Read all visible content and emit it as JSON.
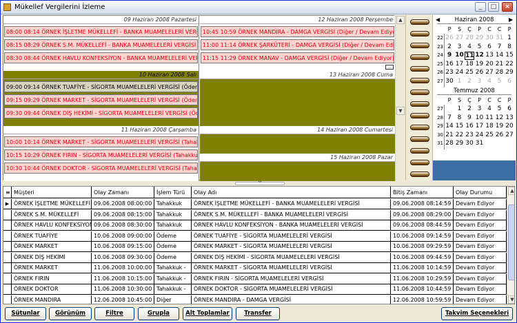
{
  "window": {
    "title": "Mükellef Vergilerini İzleme"
  },
  "schedule": {
    "days": [
      {
        "header": "09 Haziran 2008 Pazartesi",
        "olive": false,
        "appointments": [
          {
            "text": "08:00 08:14 ÖRNEK İŞLETME MÜKELLEFİ - BANKA MUAMELELERİ VERGİSİ",
            "style": "red"
          },
          {
            "text": "08:15 08:29 ÖRNEK S.M. MÜKELLEFİ - BANKA MUAMELELERİ VERGİSİ",
            "style": "red"
          },
          {
            "text": "08:30 08:44 ÖRNEK HAVLU KONFEKSİYON - BANKA MUAMELELERİ VERGİSİ",
            "style": "red"
          }
        ]
      },
      {
        "header": "12 Haziran 2008 Perşembe",
        "olive": false,
        "appointments": [
          {
            "text": "10:45 10:59 ÖRNEK MANDIRA - DAMGA VERGİSİ (Diğer / Devam Ediyor)",
            "style": "red"
          },
          {
            "text": "11:00 11:14 ÖRNEK ŞARKÜTERİ - DAMGA VERGİSİ (Diğer / Devam Ediyor)",
            "style": "red"
          },
          {
            "text": "11:15 11:29 ÖRNEK MANAV - DAMGA VERGİSİ (Diğer / Devam Ediyor)",
            "style": "red"
          }
        ]
      },
      {
        "header": "10 Haziran 2008 Salı",
        "olive": true,
        "appointments": [
          {
            "text": "09:00 09:14 ÖRNEK TUAFİYE - SİGORTA MUAMELELERİ VERGİSİ (Ödeme)",
            "style": "olv"
          },
          {
            "text": "09:15 09:29 ÖRNEK MARKET - SİGORTA MUAMELELERİ VERGİSİ (Ödeme)",
            "style": "red"
          },
          {
            "text": "09:30 09:44 ÖRNEK DİŞ HEKİMİ - SİGORTA MUAMELELERİ VERGİSİ (Ödeme)",
            "style": "red"
          }
        ]
      },
      {
        "header": "13 Haziran 2008 Cuma",
        "olive": false,
        "appointments": []
      },
      {
        "header": "11 Haziran 2008 Çarşamba",
        "olive": false,
        "appointments": [
          {
            "text": "10:00 10:14 ÖRNEK MARKET - SİGORTA MUAMELELERİ VERGİSİ (Tahakkuk)",
            "style": "red"
          },
          {
            "text": "10:15 10:29 ÖRNEK FIRIN - SİGORTA MUAMELELERİ VERGİSİ (Tahakkuk)",
            "style": "red"
          },
          {
            "text": "10:30 10:44 ÖRNEK DOKTOR - SİGORTA MUAMELELERİ VERGİSİ (Tahakkuk)",
            "style": "red"
          }
        ]
      },
      {
        "header": "14 Haziran 2008 Cumartesi",
        "olive": false,
        "appointments": []
      },
      {
        "header": "15 Haziran 2008 Pazar",
        "olive": false,
        "appointments": []
      }
    ]
  },
  "calendar": {
    "months": [
      {
        "title": "Haziran 2008",
        "dow": [
          "P",
          "S",
          "Ç",
          "P",
          "C",
          "C",
          "P"
        ],
        "weeks": [
          {
            "num": "22",
            "days": [
              {
                "d": "26",
                "c": "gray"
              },
              {
                "d": "27",
                "c": "gray"
              },
              {
                "d": "28",
                "c": "gray"
              },
              {
                "d": "29",
                "c": "gray"
              },
              {
                "d": "30",
                "c": "gray"
              },
              {
                "d": "31",
                "c": "gray"
              },
              {
                "d": "1",
                "c": ""
              }
            ]
          },
          {
            "num": "23",
            "days": [
              {
                "d": "2",
                "c": ""
              },
              {
                "d": "3",
                "c": ""
              },
              {
                "d": "4",
                "c": ""
              },
              {
                "d": "5",
                "c": ""
              },
              {
                "d": "6",
                "c": ""
              },
              {
                "d": "7",
                "c": ""
              },
              {
                "d": "8",
                "c": ""
              }
            ]
          },
          {
            "num": "24",
            "days": [
              {
                "d": "9",
                "c": "bold"
              },
              {
                "d": "10",
                "c": "bold"
              },
              {
                "d": "11",
                "c": "bold today"
              },
              {
                "d": "12",
                "c": "bold"
              },
              {
                "d": "13",
                "c": ""
              },
              {
                "d": "14",
                "c": ""
              },
              {
                "d": "15",
                "c": ""
              }
            ]
          },
          {
            "num": "25",
            "days": [
              {
                "d": "16",
                "c": ""
              },
              {
                "d": "17",
                "c": ""
              },
              {
                "d": "18",
                "c": ""
              },
              {
                "d": "19",
                "c": ""
              },
              {
                "d": "20",
                "c": ""
              },
              {
                "d": "21",
                "c": ""
              },
              {
                "d": "22",
                "c": ""
              }
            ]
          },
          {
            "num": "26",
            "days": [
              {
                "d": "23",
                "c": ""
              },
              {
                "d": "24",
                "c": ""
              },
              {
                "d": "25",
                "c": ""
              },
              {
                "d": "26",
                "c": ""
              },
              {
                "d": "27",
                "c": ""
              },
              {
                "d": "28",
                "c": ""
              },
              {
                "d": "29",
                "c": ""
              }
            ]
          },
          {
            "num": "27",
            "days": [
              {
                "d": "30",
                "c": ""
              },
              {
                "d": "1",
                "c": "gray"
              },
              {
                "d": "2",
                "c": "gray"
              },
              {
                "d": "3",
                "c": "gray"
              },
              {
                "d": "4",
                "c": "gray"
              },
              {
                "d": "5",
                "c": "gray"
              },
              {
                "d": "6",
                "c": "gray"
              }
            ]
          }
        ]
      },
      {
        "title": "Temmuz 2008",
        "dow": [
          "P",
          "S",
          "Ç",
          "P",
          "C",
          "C",
          "P"
        ],
        "weeks": [
          {
            "num": "27",
            "days": [
              {
                "d": "",
                "c": ""
              },
              {
                "d": "1",
                "c": ""
              },
              {
                "d": "2",
                "c": ""
              },
              {
                "d": "3",
                "c": ""
              },
              {
                "d": "4",
                "c": ""
              },
              {
                "d": "5",
                "c": ""
              },
              {
                "d": "6",
                "c": ""
              }
            ]
          },
          {
            "num": "28",
            "days": [
              {
                "d": "7",
                "c": ""
              },
              {
                "d": "8",
                "c": ""
              },
              {
                "d": "9",
                "c": ""
              },
              {
                "d": "10",
                "c": ""
              },
              {
                "d": "11",
                "c": ""
              },
              {
                "d": "12",
                "c": ""
              },
              {
                "d": "13",
                "c": ""
              }
            ]
          },
          {
            "num": "29",
            "days": [
              {
                "d": "14",
                "c": ""
              },
              {
                "d": "15",
                "c": ""
              },
              {
                "d": "16",
                "c": ""
              },
              {
                "d": "17",
                "c": ""
              },
              {
                "d": "18",
                "c": ""
              },
              {
                "d": "19",
                "c": ""
              },
              {
                "d": "20",
                "c": ""
              }
            ]
          },
          {
            "num": "30",
            "days": [
              {
                "d": "21",
                "c": ""
              },
              {
                "d": "22",
                "c": ""
              },
              {
                "d": "23",
                "c": ""
              },
              {
                "d": "24",
                "c": ""
              },
              {
                "d": "25",
                "c": ""
              },
              {
                "d": "26",
                "c": ""
              },
              {
                "d": "27",
                "c": ""
              }
            ]
          },
          {
            "num": "31",
            "days": [
              {
                "d": "28",
                "c": ""
              },
              {
                "d": "29",
                "c": ""
              },
              {
                "d": "30",
                "c": ""
              },
              {
                "d": "31",
                "c": ""
              },
              {
                "d": "",
                "c": ""
              },
              {
                "d": "",
                "c": ""
              },
              {
                "d": "",
                "c": ""
              }
            ]
          }
        ]
      }
    ]
  },
  "grid": {
    "columns": [
      "Müşteri",
      "Olay Zamanı",
      "İşlem Türü",
      "Olay Adı",
      "Bitiş Zamanı",
      "Olay Durumu"
    ],
    "rows": [
      [
        "ÖRNEK İŞLETME MÜKELLEFİ",
        "09.06.2008 08:00:00",
        "Tahakkuk",
        "ÖRNEK İŞLETME MÜKELLEFİ - BANKA MUAMELELERİ VERGİSİ",
        "09.06.2008 08:14:59",
        "Devam Ediyor"
      ],
      [
        "ÖRNEK S.M. MÜKELLEFİ",
        "09.06.2008 08:15:00",
        "Tahakkuk",
        "ÖRNEK S.M. MÜKELLEFİ - BANKA MUAMELELERİ VERGİSİ",
        "09.06.2008 08:29:00",
        "Devam Ediyor"
      ],
      [
        "ÖRNEK HAVLU KONFEKSİYON",
        "09.06.2008 08:30:00",
        "Tahakkuk",
        "ÖRNEK HAVLU KONFEKSİYON - BANKA MUAMELELERİ VERGİSİ",
        "09.06.2008 08:44:59",
        "Devam Ediyor"
      ],
      [
        "ÖRNEK TUAFİYE",
        "10.06.2008 09:00:00",
        "Ödeme",
        "ÖRNEK TUAFİYE - SİGORTA MUAMELELERİ VERGİSİ",
        "10.06.2008 09:14:59",
        "Devam Ediyor"
      ],
      [
        "ÖRNEK MARKET",
        "10.06.2008 09:15:00",
        "Ödeme",
        "ÖRNEK MARKET - SİGORTA MUAMELELERİ VERGİSİ",
        "10.06.2008 09:29:59",
        "Devam Ediyor"
      ],
      [
        "ÖRNEK DİŞ HEKİMİ",
        "10.06.2008 09:30:00",
        "Ödeme",
        "ÖRNEK DİŞ HEKİMİ - SİGORTA MUAMELELERİ VERGİSİ",
        "10.06.2008 09:44:59",
        "Devam Ediyor"
      ],
      [
        "ÖRNEK MARKET",
        "11.06.2008 10:00:00",
        "Tahakkuk - ",
        "ÖRNEK MARKET - SİGORTA MUAMELELERİ VERGİSİ",
        "11.06.2008 10:14:59",
        "Devam Ediyor"
      ],
      [
        "ÖRNEK FIRIN",
        "11.06.2008 10:15:00",
        "Tahakkuk - ",
        "ÖRNEK FIRIN - SİGORTA MUAMELELERİ VERGİSİ",
        "11.06.2008 10:29:59",
        "Devam Ediyor"
      ],
      [
        "ÖRNEK DOKTOR",
        "11.06.2008 10:30:00",
        "Tahakkuk - ",
        "ÖRNEK DOKTOR - SİGORTA MUAMELELERİ VERGİSİ",
        "11.06.2008 10:44:59",
        "Devam Ediyor"
      ],
      [
        "ÖRNEK MANDIRA",
        "12.06.2008 10:45:00",
        "Diğer",
        "ÖRNEK MANDIRA - DAMGA VERGİSİ",
        "12.06.2008 10:59:59",
        "Devam Ediyor"
      ],
      [
        "ÖRNEK ŞARKÜTERİ",
        "12.06.2008 11:00:00",
        "Diğer",
        "ÖRNEK ŞARKÜTERİ - DAMGA VERGİSİ",
        "12.06.2008 11:14:59",
        "Devam Ediyor"
      ]
    ]
  },
  "buttons": {
    "columns": "Sütunlar",
    "view": "Görünüm",
    "filter": "Filtre",
    "group": "Grupla",
    "subtotals": "Alt Toplamlar",
    "transfer": "Transfer",
    "calendar_options": "Takvim Seçenekleri"
  },
  "icons": {
    "grid_selector": "▶",
    "scroll_up": "▲",
    "scroll_down": "▼",
    "nav_prev": "◀",
    "nav_next": "▶",
    "split_grip": "︾",
    "more": "…"
  }
}
